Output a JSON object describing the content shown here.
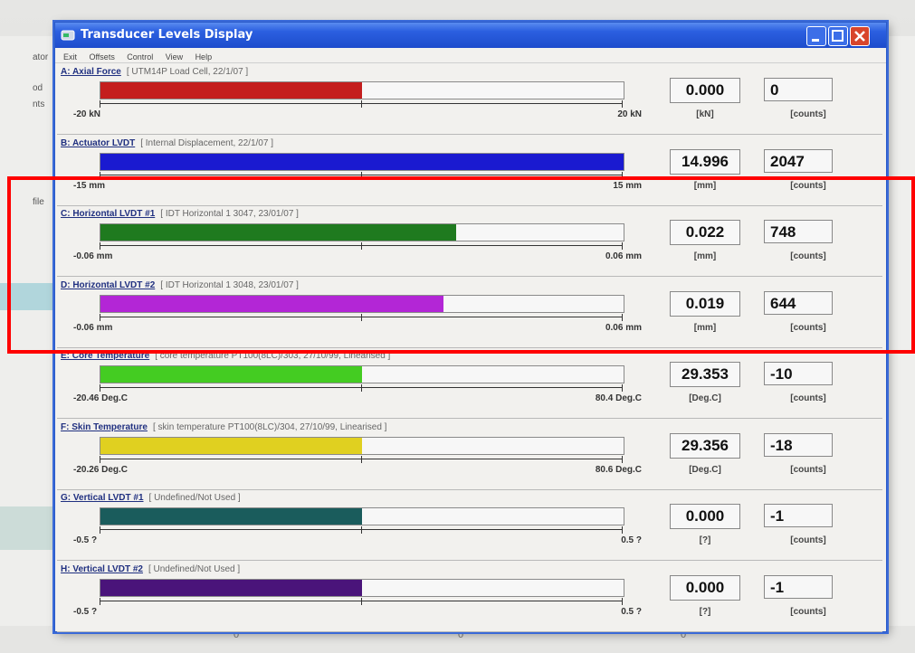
{
  "window": {
    "title": "Transducer Levels Display",
    "menu": [
      "Exit",
      "Offsets",
      "Control",
      "View",
      "Help"
    ]
  },
  "colors": {
    "title_bar": "#2b5fe0",
    "highlight": "#ff0000"
  },
  "panels": [
    {
      "label": "A: Axial Force",
      "desc": "[ UTM14P Load Cell, 22/1/07 ]",
      "min": "-20 kN",
      "max": "20 kN",
      "value": "0.000",
      "unit": "[kN]",
      "counts": "0",
      "counts_unit": "[counts]",
      "fill_fraction": 0.5,
      "color": "#c41e1e"
    },
    {
      "label": "B: Actuator LVDT",
      "desc": "[ Internal Displacement, 22/1/07 ]",
      "min": "-15 mm",
      "max": "15 mm",
      "value": "14.996",
      "unit": "[mm]",
      "counts": "2047",
      "counts_unit": "[counts]",
      "fill_fraction": 1.0,
      "color": "#1a1ad0"
    },
    {
      "label": "C: Horizontal LVDT #1",
      "desc": "[ IDT Horizontal 1 3047, 23/01/07 ]",
      "min": "-0.06 mm",
      "max": "0.06 mm",
      "value": "0.022",
      "unit": "[mm]",
      "counts": "748",
      "counts_unit": "[counts]",
      "fill_fraction": 0.68,
      "color": "#1f7a1f"
    },
    {
      "label": "D: Horizontal LVDT #2",
      "desc": "[ IDT Horizontal 1 3048, 23/01/07 ]",
      "min": "-0.06 mm",
      "max": "0.06 mm",
      "value": "0.019",
      "unit": "[mm]",
      "counts": "644",
      "counts_unit": "[counts]",
      "fill_fraction": 0.655,
      "color": "#b326d6"
    },
    {
      "label": "E: Core Temperature",
      "desc": "[ core temperature PT100(8LC)/303, 27/10/99, Linearised ]",
      "min": "-20.46 Deg.C",
      "max": "80.4 Deg.C",
      "value": "29.353",
      "unit": "[Deg.C]",
      "counts": "-10",
      "counts_unit": "[counts]",
      "fill_fraction": 0.5,
      "color": "#44cc22"
    },
    {
      "label": "F: Skin Temperature",
      "desc": "[ skin temperature PT100(8LC)/304, 27/10/99, Linearised ]",
      "min": "-20.26 Deg.C",
      "max": "80.6 Deg.C",
      "value": "29.356",
      "unit": "[Deg.C]",
      "counts": "-18",
      "counts_unit": "[counts]",
      "fill_fraction": 0.5,
      "color": "#e0d020"
    },
    {
      "label": "G: Vertical LVDT #1",
      "desc": "[ Undefined/Not Used ]",
      "min": "-0.5 ?",
      "max": "0.5 ?",
      "value": "0.000",
      "unit": "[?]",
      "counts": "-1",
      "counts_unit": "[counts]",
      "fill_fraction": 0.5,
      "color": "#1a5c5c"
    },
    {
      "label": "H: Vertical LVDT #2",
      "desc": "[ Undefined/Not Used ]",
      "min": "-0.5 ?",
      "max": "0.5 ?",
      "value": "0.000",
      "unit": "[?]",
      "counts": "-1",
      "counts_unit": "[counts]",
      "fill_fraction": 0.5,
      "color": "#4a147a"
    }
  ]
}
